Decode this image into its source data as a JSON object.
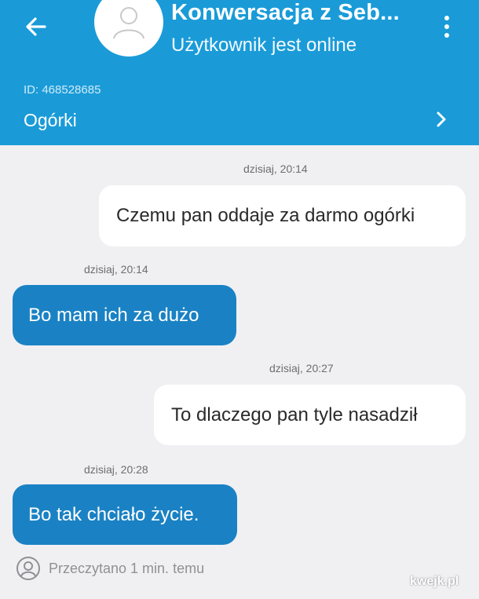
{
  "header": {
    "title": "Konwersacja z Seb...",
    "status": "Użytkownik jest online",
    "conversation_id": "ID: 468528685",
    "listing_title": "Ogórki",
    "color": "#1a9bd8"
  },
  "icons": {
    "back": "arrow-left-icon",
    "avatar": "user-silhouette-icon",
    "menu": "more-vertical-icon",
    "chevron": "chevron-right-icon",
    "read": "user-circle-icon"
  },
  "messages": [
    {
      "direction": "out",
      "time": "dzisiaj, 20:14",
      "text": "Czemu pan oddaje za darmo ogórki"
    },
    {
      "direction": "in",
      "time": "dzisiaj, 20:14",
      "text": "Bo mam ich za dużo"
    },
    {
      "direction": "out",
      "time": "dzisiaj, 20:27",
      "text": "To dlaczego pan tyle nasadził"
    },
    {
      "direction": "in",
      "time": "dzisiaj, 20:28",
      "text": "Bo tak chciało życie."
    }
  ],
  "read_status": "Przeczytano 1 min. temu",
  "watermark": "kwejk.pl"
}
